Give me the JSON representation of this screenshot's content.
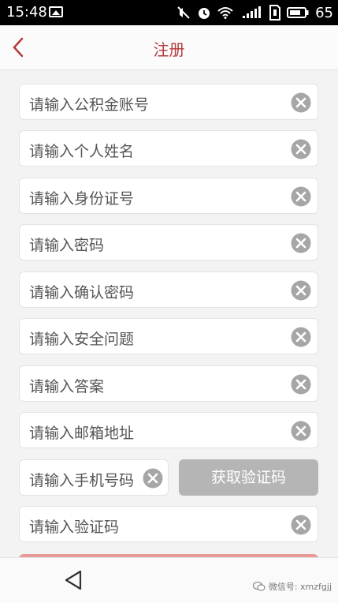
{
  "status_bar": {
    "time": "15:48",
    "battery_percent": "65",
    "icons": [
      "image-icon",
      "mute-icon",
      "alarm-icon",
      "wifi-icon",
      "signal-icon",
      "sim-icon",
      "battery-icon"
    ]
  },
  "header": {
    "title": "注册",
    "back_icon": "chevron-left-icon"
  },
  "form": {
    "fields": [
      {
        "placeholder": "请输入公积金账号"
      },
      {
        "placeholder": "请输入个人姓名"
      },
      {
        "placeholder": "请输入身份证号"
      },
      {
        "placeholder": "请输入密码"
      },
      {
        "placeholder": "请输入确认密码"
      },
      {
        "placeholder": "请输入安全问题"
      },
      {
        "placeholder": "请输入答案"
      },
      {
        "placeholder": "请输入邮箱地址"
      }
    ],
    "phone_placeholder": "请输入手机号码",
    "get_code_button": "获取验证码",
    "code_placeholder": "请输入验证码"
  },
  "watermark": "微信号: xmzfgjj",
  "colors": {
    "accent": "#b23c3c",
    "button_disabled": "#b5b5b5",
    "submit": "#e59a96",
    "clear_icon": "#a6a6a6"
  }
}
